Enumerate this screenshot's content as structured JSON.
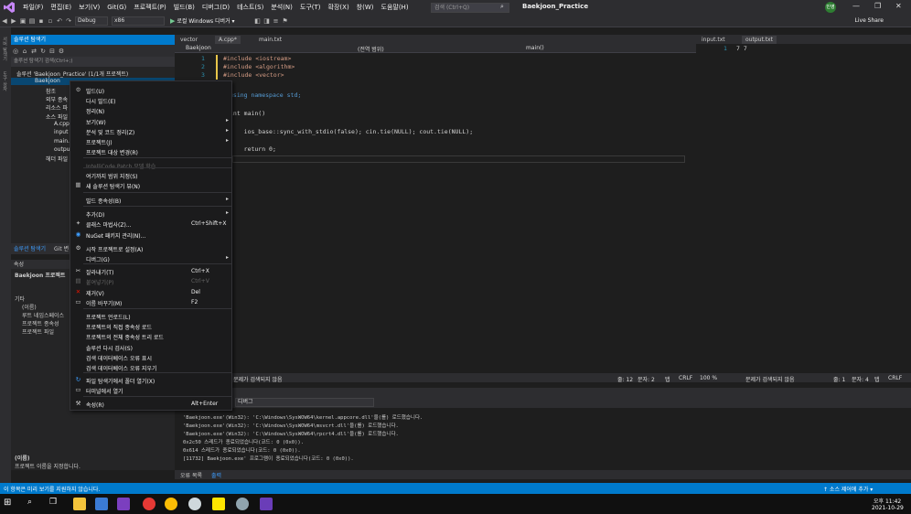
{
  "window": {
    "menu": [
      "파일(F)",
      "편집(E)",
      "보기(V)",
      "Git(G)",
      "프로젝트(P)",
      "빌드(B)",
      "디버그(D)",
      "테스트(S)",
      "분석(N)",
      "도구(T)",
      "확장(X)",
      "창(W)",
      "도움말(H)"
    ],
    "search_placeholder": "검색 (Ctrl+Q)",
    "solution_title": "Baekjoon_Practice",
    "signin_initials": "민영",
    "live_share": "Live Share"
  },
  "toolbar": {
    "config": "Debug",
    "platform": "x86",
    "run_label": "로컬 Windows 디버거 ▾"
  },
  "solution_explorer": {
    "title": "솔루션 탐색기",
    "search_placeholder": "솔루션 탐색기 검색(Ctrl+;)",
    "solution_label": "솔루션 'Baekjoon_Practice' (1/1개 프로젝트)",
    "project_label": "Baekjoon",
    "tree": [
      "참조",
      "외부 종속",
      "리소스 파",
      "소스 파일",
      "A.cpp",
      "input",
      "main.",
      "outpu",
      "헤더 파일"
    ],
    "tabs": [
      "솔루션 탐색기",
      "Git 변"
    ]
  },
  "properties": {
    "title": "속성",
    "object": "Baekjoon 프로젝트",
    "category": "기타",
    "rows": [
      "(이름)",
      "루트 네임스페이스",
      "프로젝트 종속성",
      "프로젝트 파일"
    ],
    "desc_title": "(이름)",
    "desc_text": "프로젝트 이름을 지정합니다."
  },
  "editor": {
    "tabs": [
      "vector",
      "A.cpp*",
      "main.txt"
    ],
    "nav_project": "Baekjoon",
    "nav_scope": "(전역 범위)",
    "nav_func": "main()",
    "line_numbers": [
      "1",
      "2",
      "3"
    ],
    "code_lines": [
      "#include <iostream>",
      "#include <algorithm>",
      "#include <vector>",
      "using namespace std;",
      "int main()",
      "    ios_base::sync_with_stdio(false); cin.tie(NULL); cout.tie(NULL);",
      "    return 0;"
    ],
    "status": {
      "issues": "문제가 검색되지 않음",
      "line": "줄: 12",
      "col": "문자: 2",
      "tab": "탭",
      "eol": "CRLF"
    }
  },
  "right_editor": {
    "tabs": [
      "input.txt",
      "output.txt"
    ],
    "line_number": "1",
    "content": "7 7",
    "status": {
      "zoom": "100 %",
      "issues": "문제가 검색되지 않음",
      "line": "줄: 1",
      "col": "문자: 4",
      "tab": "탭",
      "eol": "CRLF"
    }
  },
  "output": {
    "title": "출력",
    "source": "디버그",
    "lines": [
      "'Baekjoon.exe'(Win32): 'C:\\Windows\\SysWOW64\\kernel.appcore.dll'을(를) 로드했습니다.",
      "'Baekjoon.exe'(Win32): 'C:\\Windows\\SysWOW64\\msvcrt.dll'을(를) 로드했습니다.",
      "'Baekjoon.exe'(Win32): 'C:\\Windows\\SysWOW64\\rpcrt4.dll'을(를) 로드했습니다.",
      "0x2c50 스레드가 종료되었습니다(코드: 0 (0x0)).",
      "0x614 스레드가 종료되었습니다(코드: 0 (0x0)).",
      "[11732] Baekjoon.exe' 프로그램이 종료되었습니다(코드: 0 (0x0))."
    ],
    "tabs": [
      "오류 목록",
      "출력"
    ]
  },
  "statusbar": {
    "message": "이 항목은 미리 보기를 지원하지 않습니다.",
    "source_control": "↑ 소스 제어에 추가 ▾"
  },
  "taskbar": {
    "time": "오후 11:42",
    "date": "2021-10-29"
  },
  "context_menu": {
    "items": [
      {
        "label": "빌드(U)",
        "shortcut": "",
        "icon": "build-icon",
        "arrow": false,
        "disabled": false
      },
      {
        "label": "다시 빌드(E)",
        "shortcut": "",
        "icon": "",
        "arrow": false,
        "disabled": false
      },
      {
        "label": "정리(N)",
        "shortcut": "",
        "icon": "",
        "arrow": false,
        "disabled": false
      },
      {
        "label": "보기(W)",
        "shortcut": "",
        "icon": "",
        "arrow": true,
        "disabled": false
      },
      {
        "label": "분석 및 코드 정리(Z)",
        "shortcut": "",
        "icon": "",
        "arrow": true,
        "disabled": false
      },
      {
        "label": "프로젝트(J)",
        "shortcut": "",
        "icon": "",
        "arrow": true,
        "disabled": false
      },
      {
        "label": "프로젝트 대상 변경(R)",
        "shortcut": "",
        "icon": "",
        "arrow": false,
        "disabled": false
      },
      {
        "label": "IntelliCode Patch 모델 학습",
        "shortcut": "",
        "icon": "",
        "arrow": false,
        "disabled": true
      },
      {
        "label": "여기까지 범위 지정(S)",
        "shortcut": "",
        "icon": "",
        "arrow": false,
        "disabled": false
      },
      {
        "label": "새 솔루션 탐색기 뷰(N)",
        "shortcut": "",
        "icon": "new-view-icon",
        "arrow": false,
        "disabled": false
      },
      {
        "label": "빌드 종속성(B)",
        "shortcut": "",
        "icon": "",
        "arrow": true,
        "disabled": false
      },
      {
        "label": "추가(D)",
        "shortcut": "",
        "icon": "",
        "arrow": true,
        "disabled": false
      },
      {
        "label": "클래스 마법사(Z)...",
        "shortcut": "Ctrl+Shift+X",
        "icon": "wand-icon",
        "arrow": false,
        "disabled": false
      },
      {
        "label": "NuGet 패키지 관리(N)...",
        "shortcut": "",
        "icon": "nuget-icon",
        "arrow": false,
        "disabled": false
      },
      {
        "label": "시작 프로젝트로 설정(A)",
        "shortcut": "",
        "icon": "gear-icon",
        "arrow": false,
        "disabled": false
      },
      {
        "label": "디버그(G)",
        "shortcut": "",
        "icon": "",
        "arrow": true,
        "disabled": false
      },
      {
        "label": "잘라내기(T)",
        "shortcut": "Ctrl+X",
        "icon": "cut-icon",
        "arrow": false,
        "disabled": false
      },
      {
        "label": "붙여넣기(P)",
        "shortcut": "Ctrl+V",
        "icon": "paste-icon",
        "arrow": false,
        "disabled": true
      },
      {
        "label": "제거(V)",
        "shortcut": "Del",
        "icon": "remove-icon",
        "arrow": false,
        "disabled": false
      },
      {
        "label": "이름 바꾸기(M)",
        "shortcut": "F2",
        "icon": "rename-icon",
        "arrow": false,
        "disabled": false
      },
      {
        "label": "프로젝트 언로드(L)",
        "shortcut": "",
        "icon": "",
        "arrow": false,
        "disabled": false
      },
      {
        "label": "프로젝트의 직접 종속성 로드",
        "shortcut": "",
        "icon": "",
        "arrow": false,
        "disabled": false
      },
      {
        "label": "프로젝트의 전체 종속성 트리 로드",
        "shortcut": "",
        "icon": "",
        "arrow": false,
        "disabled": false
      },
      {
        "label": "솔루션 다시 검사(S)",
        "shortcut": "",
        "icon": "",
        "arrow": false,
        "disabled": false
      },
      {
        "label": "검색 데이터베이스 오류 표시",
        "shortcut": "",
        "icon": "",
        "arrow": false,
        "disabled": false
      },
      {
        "label": "검색 데이터베이스 오류 지우기",
        "shortcut": "",
        "icon": "",
        "arrow": false,
        "disabled": false
      },
      {
        "label": "파일 탐색기에서 폴더 열기(X)",
        "shortcut": "",
        "icon": "refresh-icon",
        "arrow": false,
        "disabled": false
      },
      {
        "label": "터미널에서 열기",
        "shortcut": "",
        "icon": "terminal-icon",
        "arrow": false,
        "disabled": false
      },
      {
        "label": "속성(R)",
        "shortcut": "Alt+Enter",
        "icon": "wrench-icon",
        "arrow": false,
        "disabled": false
      }
    ]
  }
}
